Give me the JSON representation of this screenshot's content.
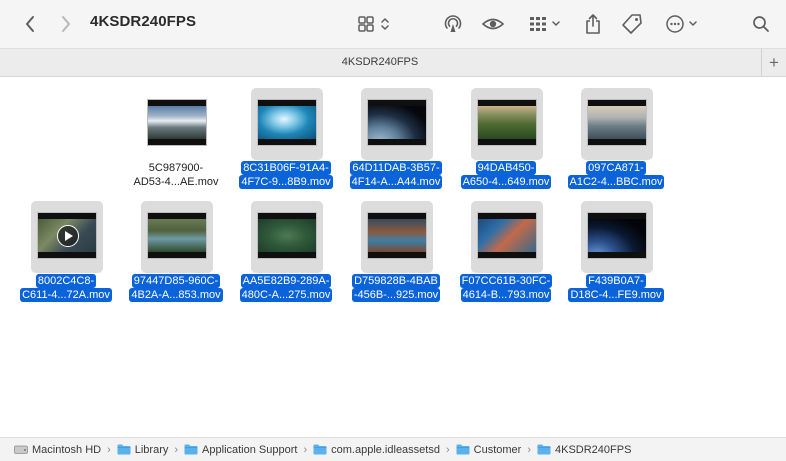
{
  "window": {
    "title": "4KSDR240FPS"
  },
  "toolbar": {
    "back_icon": "chevron-left-icon",
    "forward_icon": "chevron-right-icon",
    "view_icon": "grid-view-icon",
    "airdrop_icon": "airdrop-icon",
    "quicklook_icon": "eye-icon",
    "group_icon": "group-by-icon",
    "share_icon": "share-icon",
    "tag_icon": "tag-icon",
    "more_icon": "more-actions-icon",
    "search_icon": "search-icon"
  },
  "tabbar": {
    "title": "4KSDR240FPS",
    "add_label": "+"
  },
  "files": [
    {
      "line1": "5C987900-",
      "line2": "AD53-4...AE.mov",
      "selected": false,
      "play": false,
      "bg": "linear-gradient(180deg,#5a7da8 0%,#9fb3c8 30%,#e8eef2 45%,#6a7a80 65%,#2f3a36 100%)"
    },
    {
      "line1": "8C31B06F-91A4-",
      "line2": "4F7C-9...8B9.mov",
      "selected": true,
      "play": false,
      "bg": "radial-gradient(ellipse at 45% 40%,#e9f7ff 0%,#7cc6e4 28%,#1f86b8 55%,#0b4f7a 100%)"
    },
    {
      "line1": "64D11DAB-3B57-",
      "line2": "4F14-A...A44.mov",
      "selected": true,
      "play": false,
      "bg": "radial-gradient(ellipse at 20% 110%,#a6bdd0 0%,#5f7f9c 30%,#1e2f44 55%,#05070c 80%)"
    },
    {
      "line1": "94DAB450-",
      "line2": "A650-4...649.mov",
      "selected": true,
      "play": false,
      "bg": "linear-gradient(180deg,#c9b48a 0%,#8a8f63 25%,#4f6b32 55%,#2a4a1f 100%)"
    },
    {
      "line1": "097CA871-",
      "line2": "A1C2-4...BBC.mov",
      "selected": true,
      "play": false,
      "bg": "linear-gradient(180deg,#d9cbb8 0%,#aeb3b2 35%,#6f7f88 60%,#3f4f5a 100%)"
    },
    {
      "line1": "8002C4C8-",
      "line2": "C611-4...72A.mov",
      "selected": true,
      "play": true,
      "bg": "linear-gradient(135deg,#4b5a3a 0%,#7c8a63 35%,#3a4a56 65%,#2a3c42 100%)"
    },
    {
      "line1": "97447D85-960C-",
      "line2": "4B2A-A...853.mov",
      "selected": true,
      "play": false,
      "bg": "linear-gradient(180deg,#6a7a58 0%,#50633c 35%,#6f9aa6 60%,#2f4a2c 100%)"
    },
    {
      "line1": "AA5E82B9-289A-",
      "line2": "480C-A...275.mov",
      "selected": true,
      "play": false,
      "bg": "radial-gradient(ellipse at 50% 50%,#4d7a53 0%,#2f5b3a 45%,#1f3b2b 100%)"
    },
    {
      "line1": "D759828B-4BAB",
      "line2": "-456B-...925.mov",
      "selected": true,
      "play": false,
      "bg": "linear-gradient(180deg,#3a4a5e 0%,#8a5a40 40%,#3d7fa6 65%,#7a4a32 100%)"
    },
    {
      "line1": "F07CC61B-30FC-",
      "line2": "4614-B...793.mov",
      "selected": true,
      "play": false,
      "bg": "linear-gradient(135deg,#1f4a7a 0%,#2f6fa8 30%,#c26a4a 55%,#3a6a8a 100%)"
    },
    {
      "line1": "F439B0A7-",
      "line2": "D18C-4...FE9.mov",
      "selected": true,
      "play": false,
      "bg": "radial-gradient(ellipse at 15% 110%,#6a9ad6 0%,#2a4f8a 28%,#0a1830 55%,#020408 80%)"
    }
  ],
  "pathbar": [
    {
      "label": "Macintosh HD",
      "icon": "drive-icon"
    },
    {
      "label": "Library",
      "icon": "folder-icon"
    },
    {
      "label": "Application Support",
      "icon": "folder-icon"
    },
    {
      "label": "com.apple.idleassetsd",
      "icon": "folder-icon"
    },
    {
      "label": "Customer",
      "icon": "folder-icon"
    },
    {
      "label": "4KSDR240FPS",
      "icon": "folder-icon"
    }
  ],
  "colors": {
    "selection": "#0a63d9",
    "folder": "#5ab1ec"
  }
}
